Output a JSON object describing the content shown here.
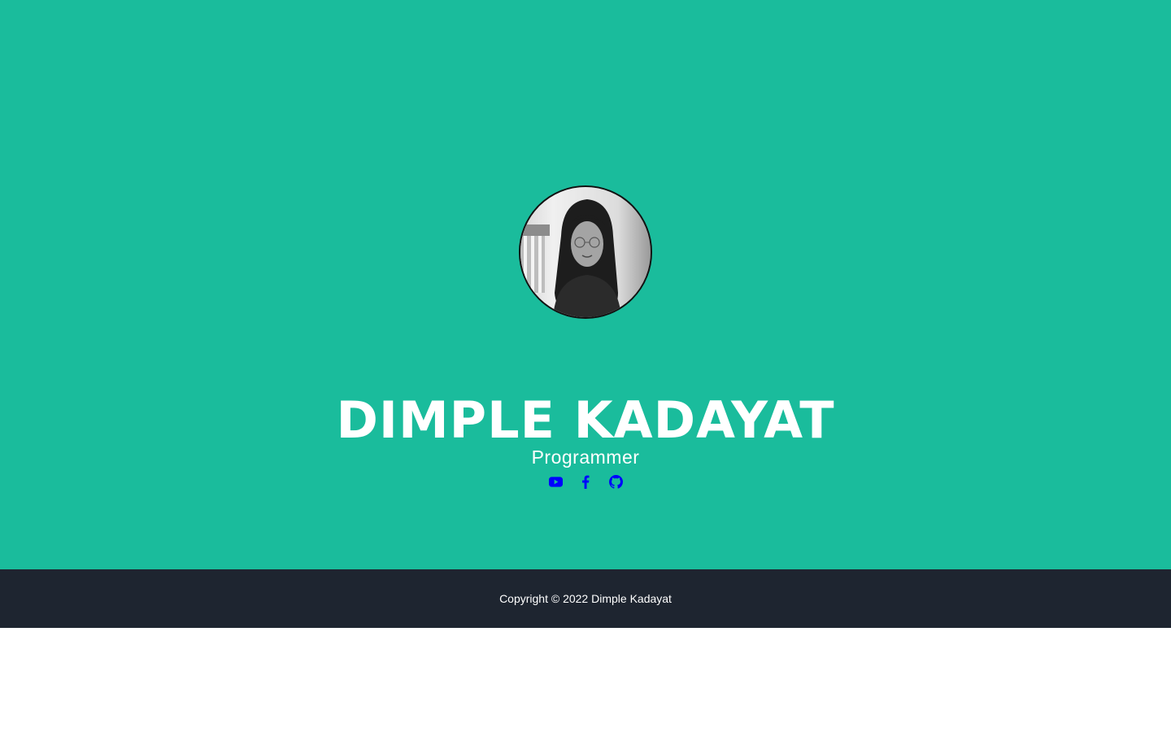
{
  "colors": {
    "hero_background": "#1abc9c",
    "footer_background": "#1e2530",
    "text": "#ffffff",
    "icon": "#0000ff"
  },
  "profile": {
    "name": "DIMPLE KADAYAT",
    "role": "Programmer"
  },
  "social": [
    {
      "icon": "youtube-icon"
    },
    {
      "icon": "facebook-icon"
    },
    {
      "icon": "github-icon"
    }
  ],
  "footer": {
    "copyright": "Copyright © 2022 Dimple Kadayat"
  }
}
